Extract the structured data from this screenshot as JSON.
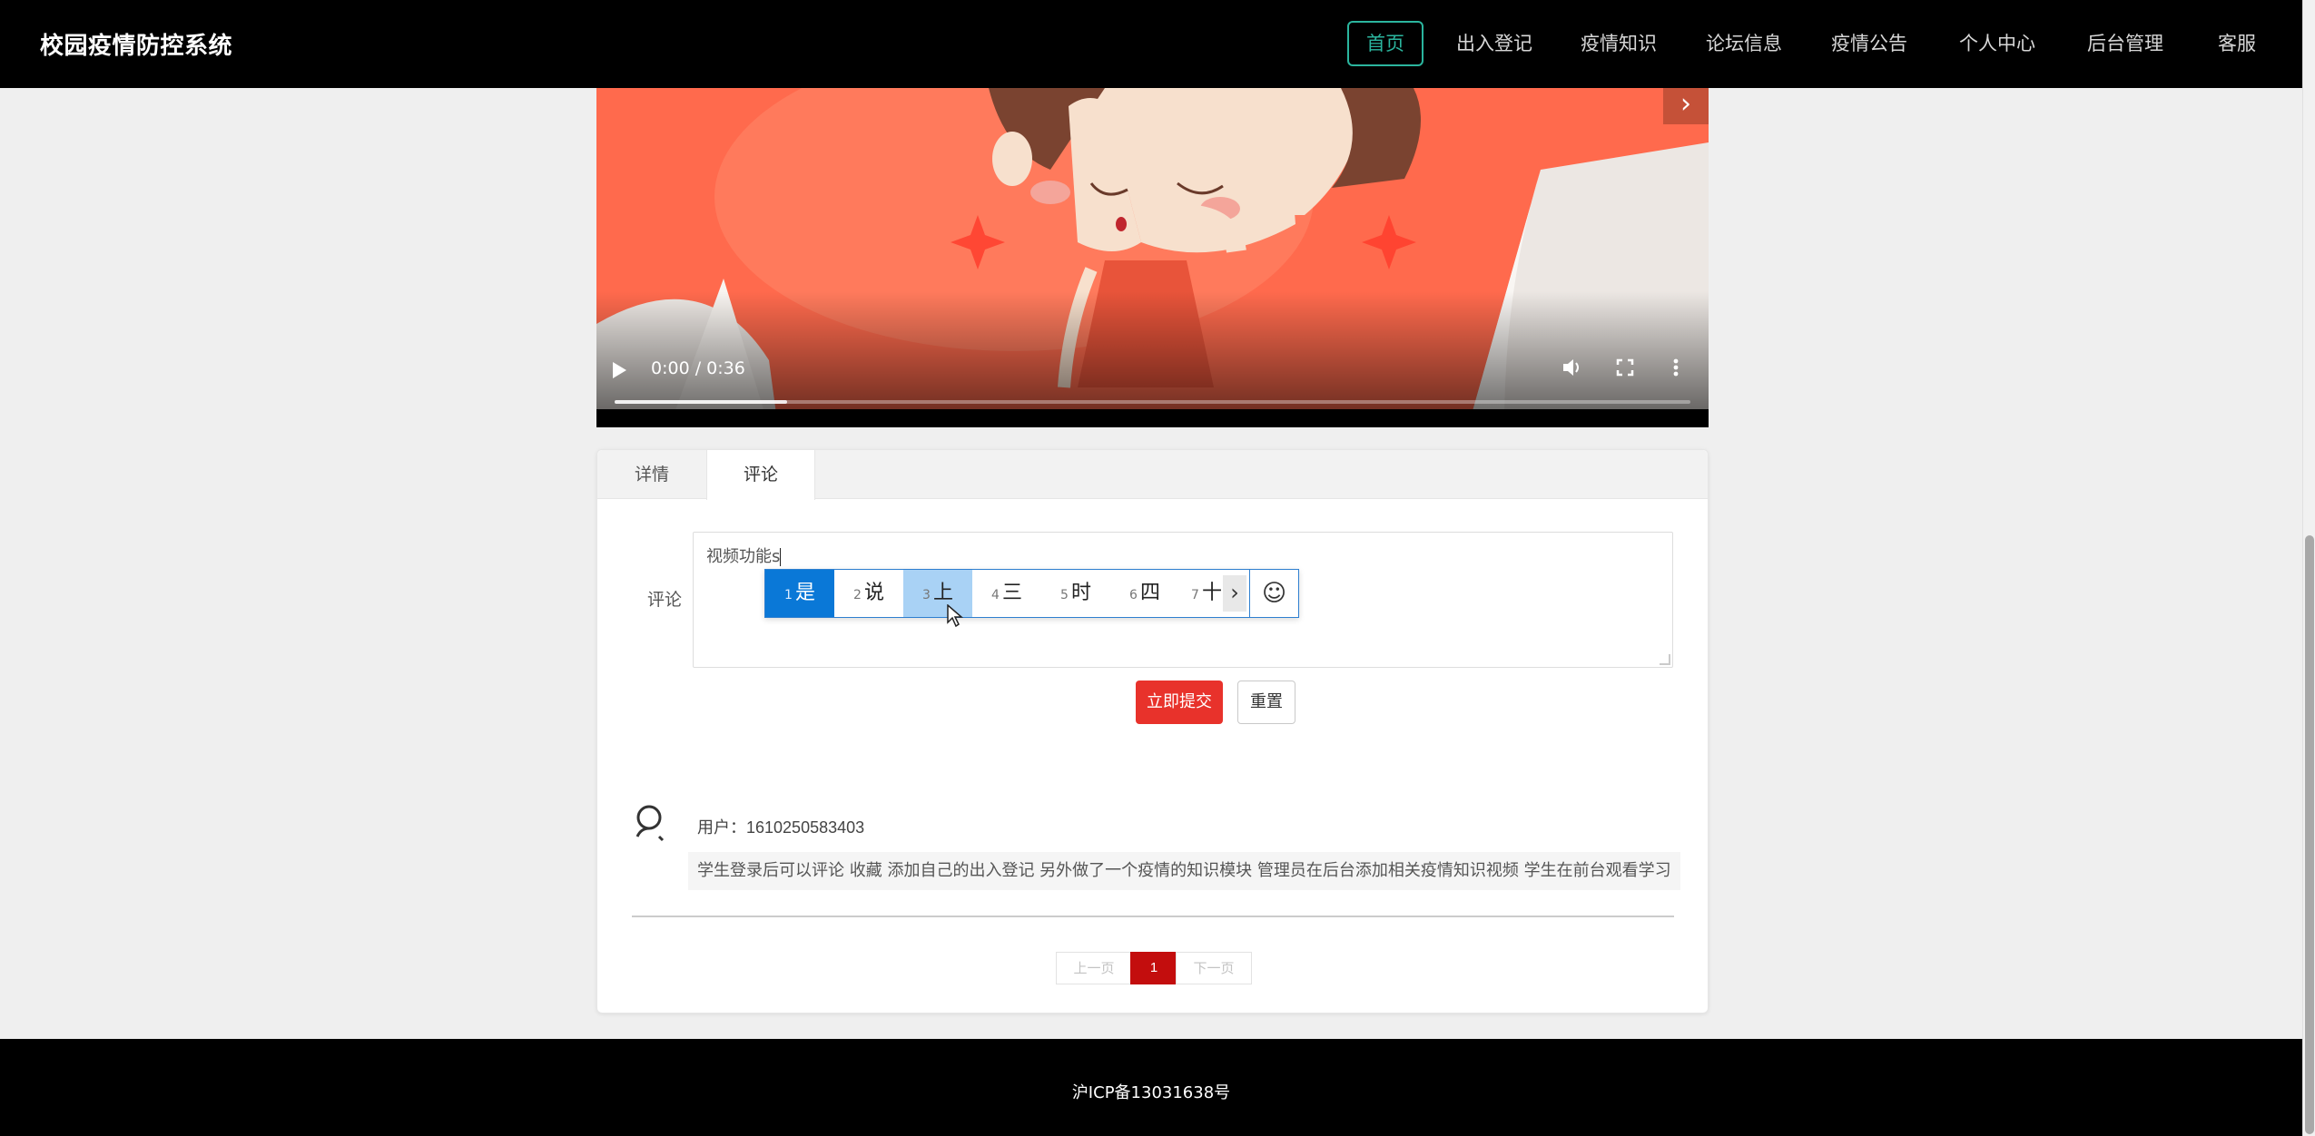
{
  "header": {
    "brand": "校园疫情防控系统",
    "nav": [
      {
        "label": "首页",
        "active": true
      },
      {
        "label": "出入登记"
      },
      {
        "label": "疫情知识"
      },
      {
        "label": "论坛信息"
      },
      {
        "label": "疫情公告"
      },
      {
        "label": "个人中心"
      },
      {
        "label": "后台管理"
      },
      {
        "label": "客服"
      }
    ],
    "accent_color": "#2bb59e"
  },
  "video": {
    "time": "0:00 / 0:36",
    "progress": 0.16,
    "icons": [
      "play-icon",
      "volume-icon",
      "fullscreen-icon",
      "more-options-icon",
      "chevron-right-icon"
    ]
  },
  "tabs": [
    {
      "label": "详情"
    },
    {
      "label": "评论",
      "active": true
    }
  ],
  "comment_form": {
    "label": "评论",
    "value": "视频功能s",
    "submit_label": "立即提交",
    "reset_label": "重置",
    "submit_color": "#e8322b"
  },
  "ime": {
    "candidates": [
      {
        "n": "1",
        "text": "是"
      },
      {
        "n": "2",
        "text": "说"
      },
      {
        "n": "3",
        "text": "上"
      },
      {
        "n": "4",
        "text": "三"
      },
      {
        "n": "5",
        "text": "时"
      },
      {
        "n": "6",
        "text": "四"
      },
      {
        "n": "7",
        "text": "十"
      }
    ],
    "next": "›",
    "emoji": "☺"
  },
  "comments": [
    {
      "user_prefix": "用户：",
      "user_id": "1610250583403",
      "text": "学生登录后可以评论 收藏 添加自己的出入登记 另外做了一个疫情的知识模块 管理员在后台添加相关疫情知识视频 学生在前台观看学习"
    }
  ],
  "pagination": {
    "prev": "上一页",
    "current": "1",
    "next": "下一页",
    "active_color": "#c30d0d"
  },
  "footer": {
    "icp": "沪ICP备13031638号"
  }
}
